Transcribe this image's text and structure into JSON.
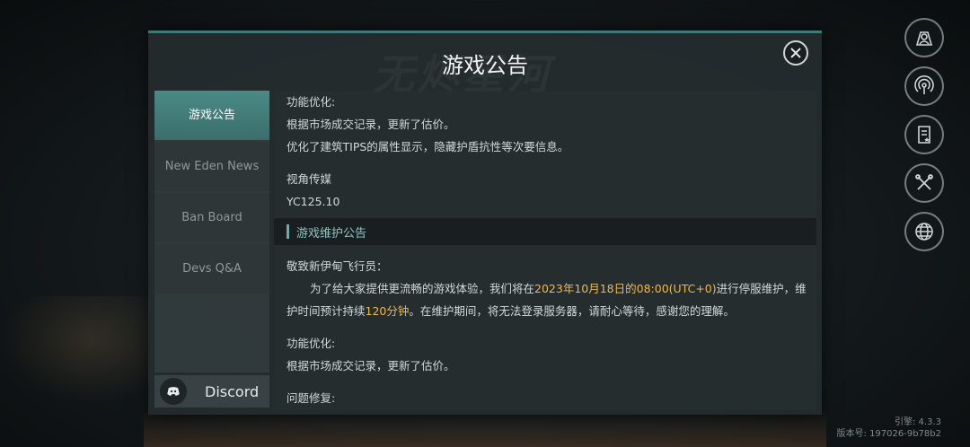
{
  "dialog": {
    "title": "游戏公告",
    "watermark": "无烬星河"
  },
  "tabs": [
    {
      "label": "游戏公告",
      "active": true
    },
    {
      "label": "New Eden News",
      "active": false
    },
    {
      "label": "Ban Board",
      "active": false
    },
    {
      "label": "Devs Q&A",
      "active": false
    }
  ],
  "discord": {
    "label": "Discord"
  },
  "content": {
    "block1_heading": "功能优化:",
    "block1_line1": "根据市场成交记录，更新了估价。",
    "block1_line2": "优化了建筑TIPS的属性显示，隐藏护盾抗性等次要信息。",
    "signature_org": "视角传媒",
    "signature_date": "YC125.10",
    "section_title": "游戏维护公告",
    "greeting": "敬致新伊甸飞行员：",
    "para_part1": "为了给大家提供更流畅的游戏体验，我们将在",
    "para_time": "2023年10月18日的08:00(UTC+0)",
    "para_part2": "进行停服维护，维护时间预计持续",
    "para_duration": "120分钟",
    "para_part3": "。在维护期间，将无法登录服务器，请耐心等待，感谢您的理解。",
    "block2_heading": "功能优化:",
    "block2_line1": "根据市场成交记录，更新了估价。",
    "block3_heading": "问题修复:"
  },
  "side_icons": [
    "profile-icon",
    "signal-icon",
    "notes-icon",
    "tools-icon",
    "globe-icon"
  ],
  "version": {
    "engine": "引擎: 4.3.3",
    "build": "版本号: 197026-9b78b2"
  },
  "colors": {
    "accent": "#4b8a86",
    "highlight": "#f0b84a",
    "section_title": "#8fc6c2"
  }
}
